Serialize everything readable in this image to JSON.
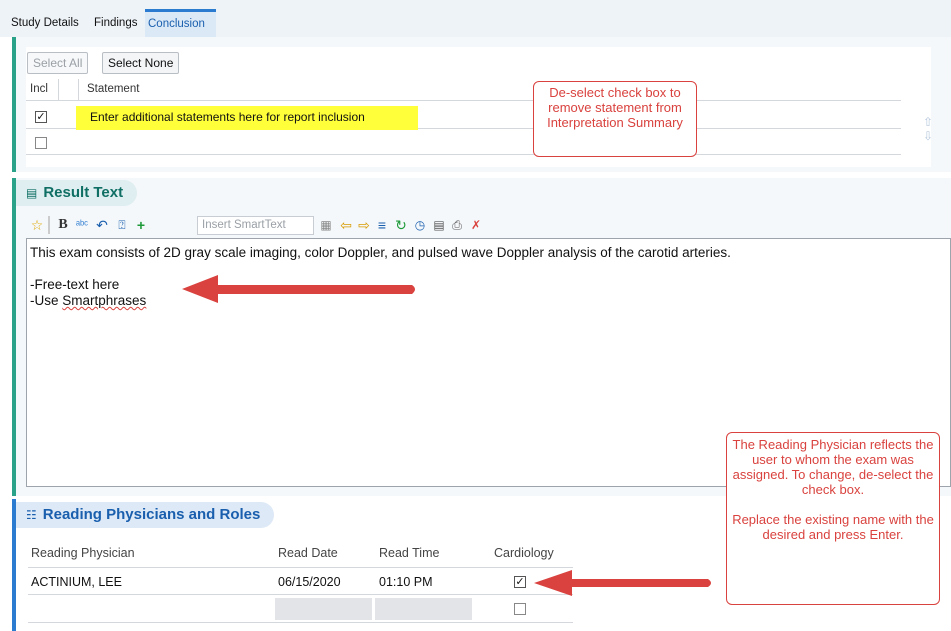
{
  "tabs": [
    {
      "label": "Study Details"
    },
    {
      "label": "Findings"
    },
    {
      "label": "Conclusion"
    }
  ],
  "statements": {
    "select_all_label": "Select All",
    "select_none_label": "Select None",
    "columns": {
      "incl": "Incl",
      "statement": "Statement"
    },
    "rows": [
      {
        "checked": true,
        "text": "Enter additional statements here for report inclusion"
      },
      {
        "checked": false,
        "text": ""
      }
    ],
    "callout": "De-select check box to remove statement from Interpretation Summary"
  },
  "result_text": {
    "title": "Result Text",
    "smarttext_placeholder": "Insert SmartText",
    "lines": [
      "This exam consists of 2D gray scale imaging, color Doppler, and pulsed wave Doppler analysis of the carotid arteries.",
      "",
      "-Free-text here",
      "-Use Smartphrases"
    ]
  },
  "reading_physicians": {
    "title": "Reading Physicians and Roles",
    "columns": {
      "physician": "Reading Physician",
      "date": "Read Date",
      "time": "Read Time",
      "role": "Cardiology"
    },
    "rows": [
      {
        "physician": "ACTINIUM, LEE",
        "date": "06/15/2020",
        "time": "01:10 PM",
        "checked": true
      },
      {
        "physician": "",
        "date": "",
        "time": "",
        "checked": false
      }
    ],
    "callout": "The Reading Physician reflects the user to whom the exam was assigned. To change, de-select the check box.\n\nReplace the existing name with the desired and press Enter."
  },
  "colors": {
    "accent_teal": "#2aa28a",
    "accent_blue": "#2b7bd0",
    "callout_red": "#d9423e",
    "highlight_yellow": "#ffff3a"
  }
}
